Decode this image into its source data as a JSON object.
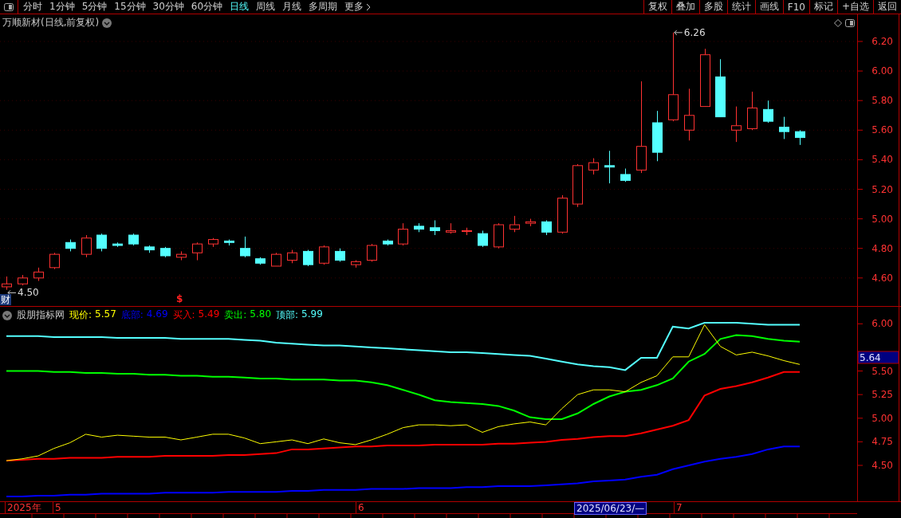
{
  "toolbar": {
    "tabs": [
      {
        "label": "分时",
        "selected": false,
        "kind": "period"
      },
      {
        "label": "1分钟",
        "selected": false,
        "kind": "period"
      },
      {
        "label": "5分钟",
        "selected": false,
        "kind": "period"
      },
      {
        "label": "15分钟",
        "selected": false,
        "kind": "period"
      },
      {
        "label": "30分钟",
        "selected": false,
        "kind": "period"
      },
      {
        "label": "60分钟",
        "selected": false,
        "kind": "period"
      },
      {
        "label": "日线",
        "selected": true,
        "kind": "period"
      },
      {
        "label": "周线",
        "selected": false,
        "kind": "period"
      },
      {
        "label": "月线",
        "selected": false,
        "kind": "period"
      },
      {
        "label": "多周期",
        "selected": false,
        "kind": "period"
      },
      {
        "label": "更多",
        "selected": false,
        "kind": "menu"
      }
    ],
    "buttons": [
      "复权",
      "叠加",
      "多股",
      "统计",
      "画线",
      "F10",
      "标记",
      "+自选",
      "返回"
    ]
  },
  "price_chart": {
    "title": "万顺新材(日线,前复权)",
    "yticks": [
      "6.20",
      "6.00",
      "5.80",
      "5.60",
      "5.40",
      "5.20",
      "5.00",
      "4.80",
      "4.60"
    ],
    "high_label": "6.26",
    "low_label": "4.50",
    "finance_marker": "财",
    "signal_marker": "$"
  },
  "indicator": {
    "name": "股朋指标网",
    "cursor_price": "5.64",
    "yticks": [
      "6.00",
      "5.50",
      "5.25",
      "5.00",
      "4.75",
      "4.50"
    ],
    "lines": [
      {
        "name": "现价:",
        "value": "5.57",
        "color": "#ffff00"
      },
      {
        "name": "底部:",
        "value": "4.69",
        "color": "#0000ff"
      },
      {
        "name": "买入:",
        "value": "5.49",
        "color": "#ff0000"
      },
      {
        "name": "卖出:",
        "value": "5.80",
        "color": "#00ff00"
      },
      {
        "name": "顶部:",
        "value": "5.99",
        "color": "#54ffff"
      }
    ]
  },
  "date_axis": {
    "labels": [
      "2025年",
      "5",
      "6",
      "7"
    ],
    "cursor_date": "2025/06/23/—"
  }
}
